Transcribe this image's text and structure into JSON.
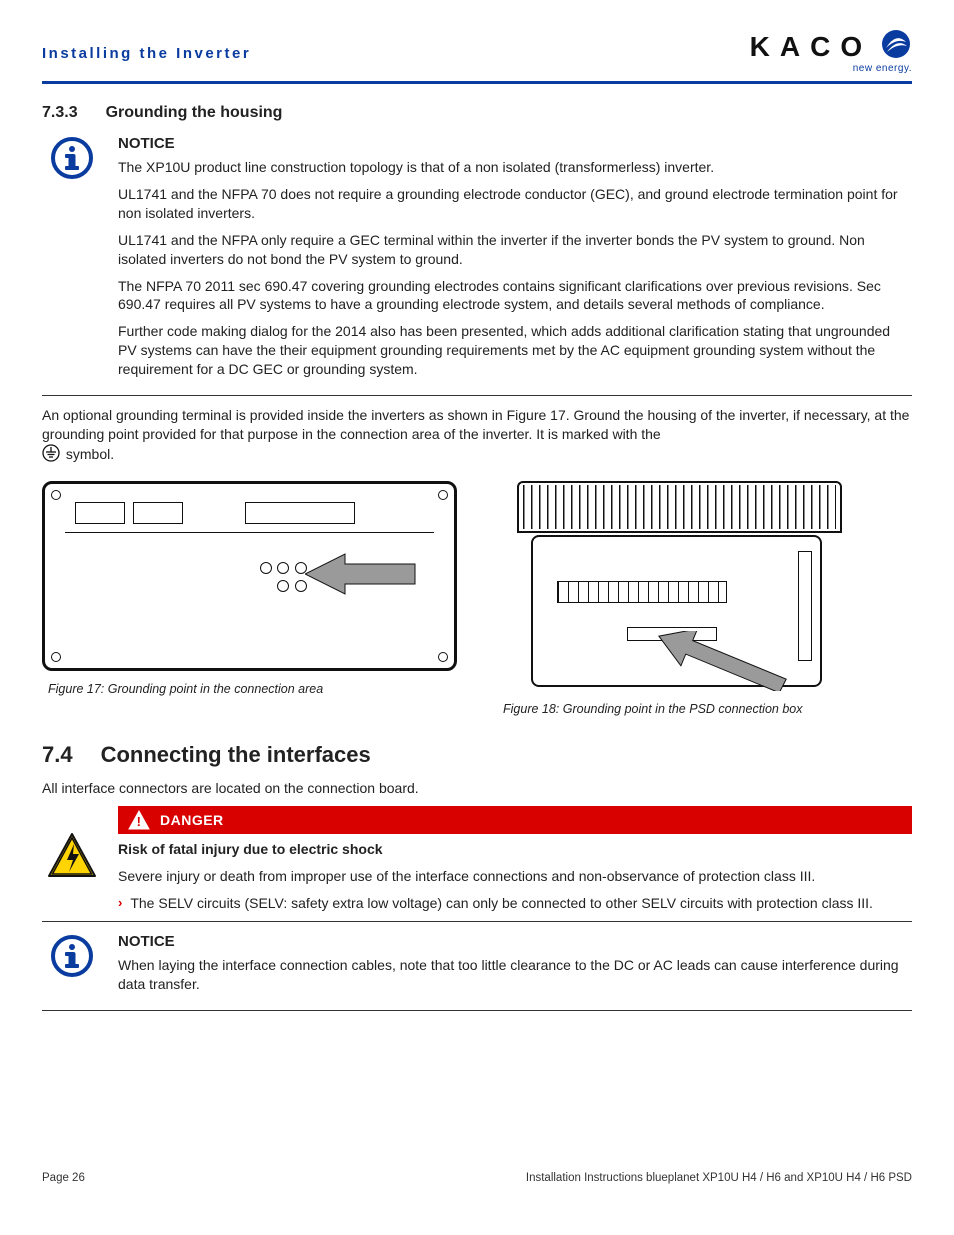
{
  "header": {
    "section_title": "Installing the Inverter",
    "logo_text": "KACO",
    "logo_sub": "new energy."
  },
  "s733": {
    "num": "7.3.3",
    "title": "Grounding the housing",
    "notice_label": "NOTICE",
    "p1": "The XP10U product line construction topology is that of a non isolated (transformerless) inverter.",
    "p2": "UL1741 and the NFPA 70 does not require a grounding electrode conductor (GEC), and ground electrode termination point for non isolated inverters.",
    "p3": "UL1741 and the NFPA only require a GEC terminal within the inverter if the inverter bonds the PV system to ground. Non isolated inverters do not bond the PV system to ground.",
    "p4": "The NFPA 70 2011 sec 690.47 covering grounding electrodes contains significant clarifications over previous revisions. Sec 690.47 requires all PV systems to have a grounding electrode system, and details several methods of compliance.",
    "p5": "Further code making dialog for the 2014 also has been presented, which adds additional clarification stating that ungrounded PV systems can have the their equipment grounding requirements met by the AC equipment grounding system without the requirement for a DC GEC or grounding system.",
    "after_p1": "An optional grounding terminal is provided inside the inverters as shown in Figure 17. Ground the housing of the inverter, if necessary, at the grounding point provided for that purpose in the connection area of the inverter. It is marked with the",
    "after_p2": "symbol.",
    "fig17": "Figure 17:  Grounding point in the connection area",
    "fig18": "Figure 18:  Grounding point in the PSD connection box"
  },
  "s74": {
    "num": "7.4",
    "title": "Connecting the interfaces",
    "intro": "All interface connectors are located on the connection board.",
    "danger_label": "DANGER",
    "danger_headline": "Risk of fatal injury due to electric shock",
    "danger_body": "Severe injury or death from improper use of the interface connections and non-observance of protection class III.",
    "danger_bullet": "The SELV circuits (SELV: safety extra low voltage) can only be connected to other SELV circuits with protection class III.",
    "notice_label": "NOTICE",
    "notice_body": "When laying the interface connection cables, note that too little clearance to the DC or AC leads can cause interference during data transfer."
  },
  "footer": {
    "left": "Page 26",
    "right": "Installation Instructions blueplanet XP10U H4 / H6 and XP10U H4 / H6 PSD"
  }
}
